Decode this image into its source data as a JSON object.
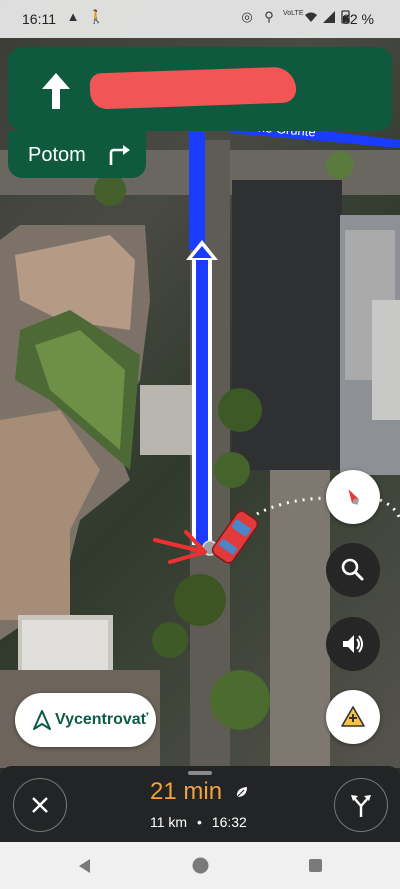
{
  "status_bar": {
    "time": "16:11",
    "battery": "62 %",
    "icons": [
      "navigation-arrow-icon",
      "walking-icon",
      "location-target-icon",
      "location-pin-icon",
      "volte-icon",
      "wifi-icon",
      "signal-icon",
      "battery-icon"
    ]
  },
  "navigation": {
    "maneuver_icon": "straight-arrow-icon",
    "street_name": "",
    "then_label": "Potom",
    "then_icon": "turn-right-icon",
    "banner_color": "#0f5a3f"
  },
  "map": {
    "street_label": "ne Grunte",
    "route_color": "#1a3cff"
  },
  "controls": {
    "recenter_label": "Vycentrovať",
    "compass_icon": "compass-icon",
    "search_icon": "search-icon",
    "sound_icon": "volume-icon",
    "report_icon": "add-report-icon"
  },
  "trip": {
    "duration": "21 min",
    "distance": "11 km",
    "separator": "•",
    "arrival": "16:32",
    "duration_color": "#f4a23b"
  }
}
